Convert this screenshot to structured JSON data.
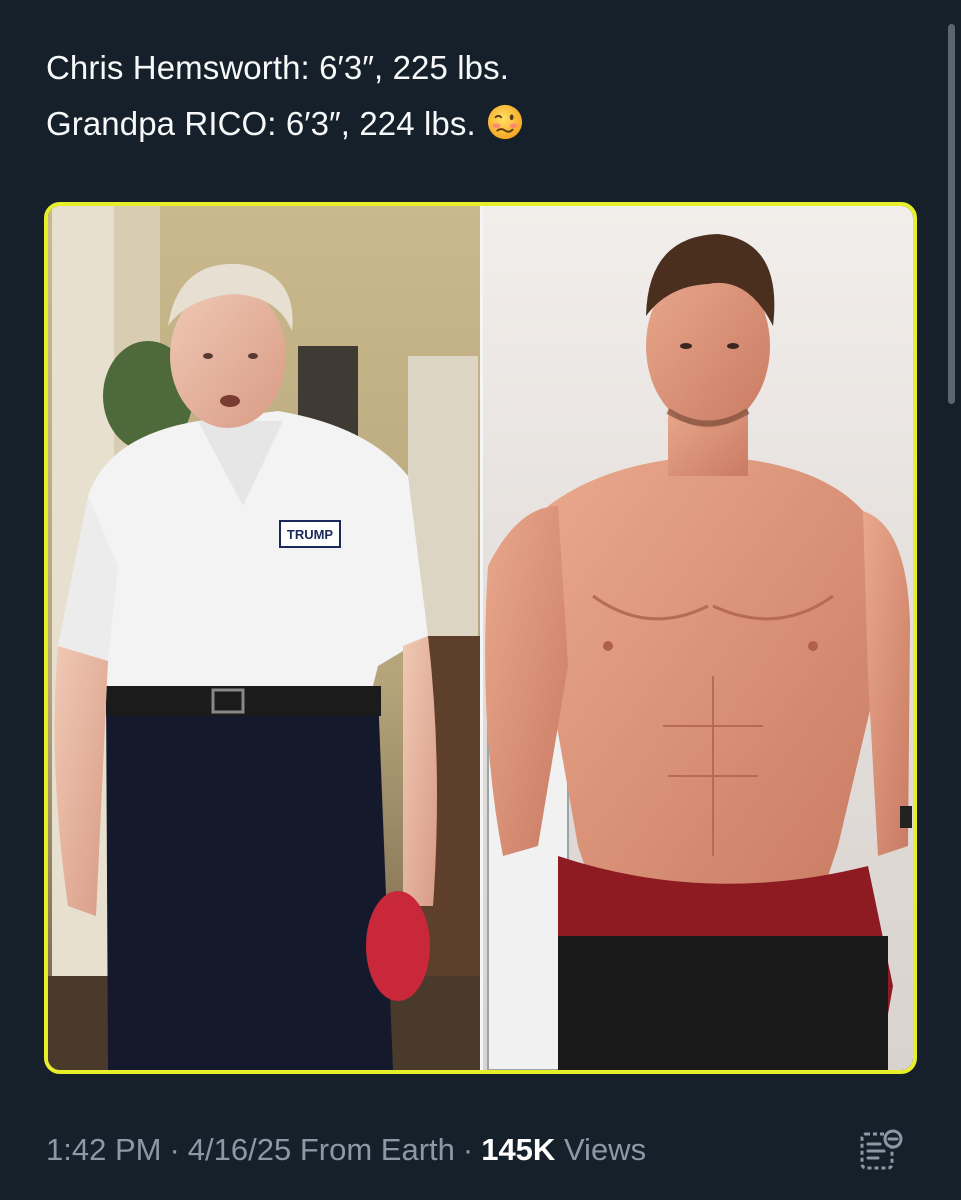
{
  "tweet": {
    "lines": [
      "Chris Hemsworth: 6′3″, 225 lbs.",
      "Grandpa RICO: 6′3″, 224 lbs."
    ],
    "emoji": "woozy-face"
  },
  "media": {
    "left_photo": {
      "shirt_logo_text": "TRUMP"
    },
    "right_photo": {}
  },
  "meta": {
    "time": "1:42 PM",
    "separator": "·",
    "date": "4/16/25",
    "source": "From Earth",
    "views_count": "145K",
    "views_label": "Views"
  },
  "icons": {
    "analytics": "analytics-icon"
  },
  "colors": {
    "background": "#15202b",
    "text": "#f7f9f9",
    "muted": "#8b98a5",
    "frame_border": "#e7ef2a"
  }
}
